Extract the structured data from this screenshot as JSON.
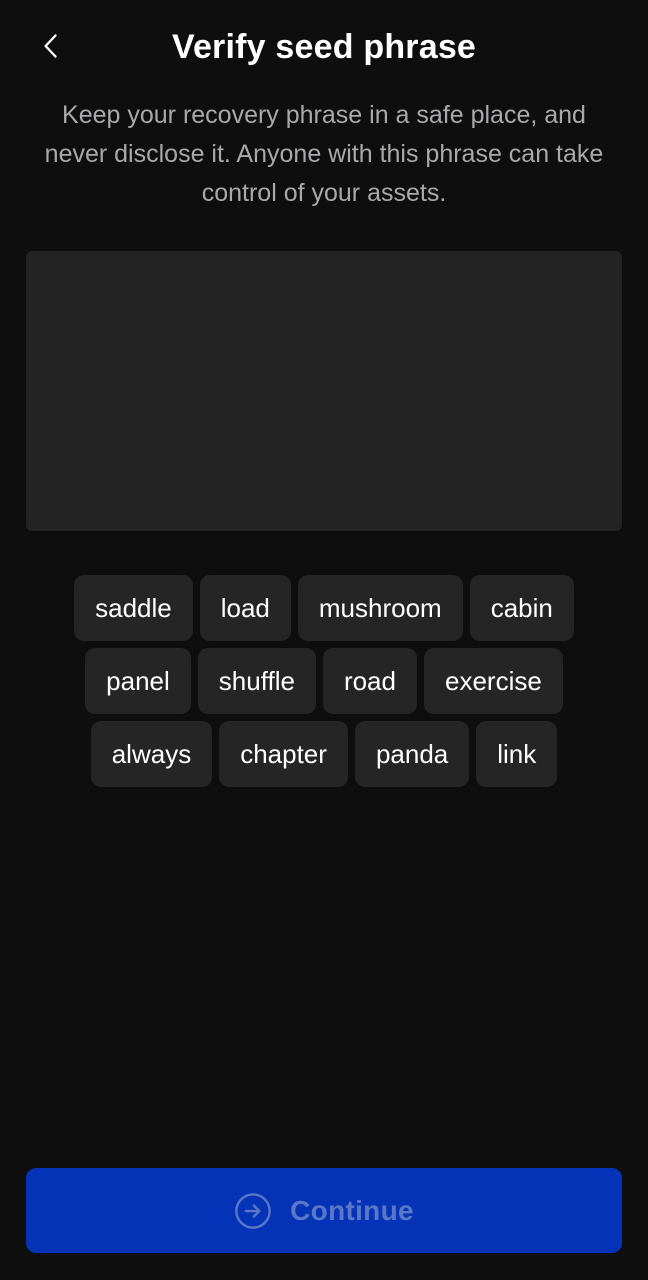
{
  "header": {
    "title": "Verify seed phrase",
    "back_icon": "chevron-left-icon"
  },
  "subtitle": "Keep your recovery phrase in a safe place, and never disclose it. Anyone with this phrase can take control of your assets.",
  "word_rows": [
    [
      "saddle",
      "load",
      "mushroom",
      "cabin"
    ],
    [
      "panel",
      "shuffle",
      "road",
      "exercise"
    ],
    [
      "always",
      "chapter",
      "panda",
      "link"
    ]
  ],
  "continue_button": {
    "label": "Continue",
    "icon": "arrow-right-circle-icon"
  },
  "colors": {
    "background": "#0e0e0f",
    "surface": "#232324",
    "chip": "#252526",
    "primary": "#0433b7",
    "primary_text_disabled": "#5a78c7",
    "muted_text": "#a9a9ab"
  }
}
